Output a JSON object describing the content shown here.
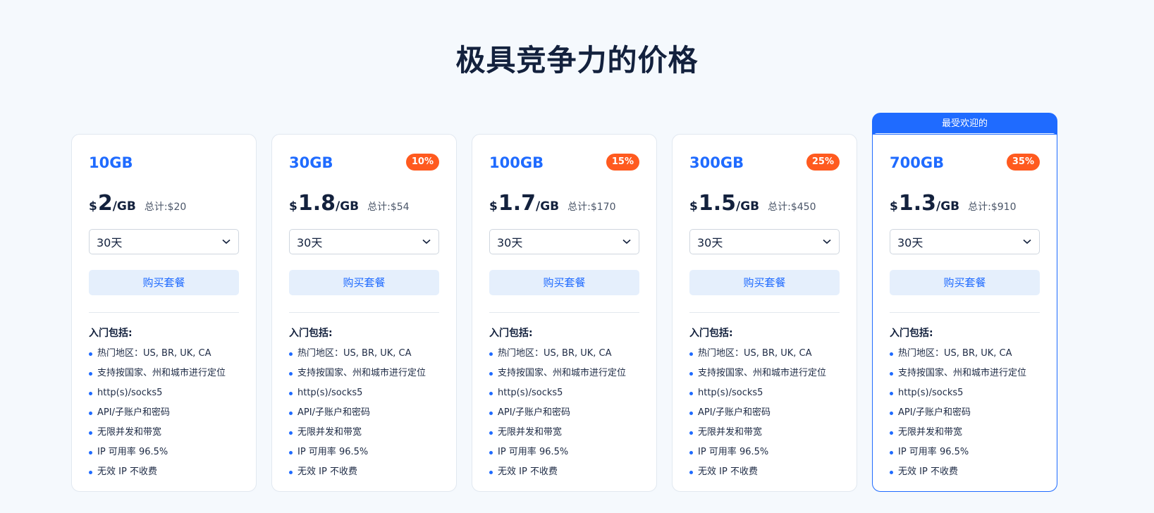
{
  "page": {
    "title": "极具竞争力的价格"
  },
  "featured_label": "最受欢迎的",
  "buy_label": "购买套餐",
  "features_heading": "入门包括:",
  "currency": "$",
  "unit": "/GB",
  "features": [
    "热门地区：US, BR, UK, CA",
    "支持按国家、州和城市进行定位",
    "http(s)/socks5",
    "API/子账户和密码",
    "无限并发和带宽",
    "IP 可用率 96.5%",
    "无效 IP 不收费"
  ],
  "plans": [
    {
      "size": "10GB",
      "badge": "",
      "price": "2",
      "total": "总计:$20",
      "duration": "30天",
      "featured": false
    },
    {
      "size": "30GB",
      "badge": "10%",
      "price": "1.8",
      "total": "总计:$54",
      "duration": "30天",
      "featured": false
    },
    {
      "size": "100GB",
      "badge": "15%",
      "price": "1.7",
      "total": "总计:$170",
      "duration": "30天",
      "featured": false
    },
    {
      "size": "300GB",
      "badge": "25%",
      "price": "1.5",
      "total": "总计:$450",
      "duration": "30天",
      "featured": false
    },
    {
      "size": "700GB",
      "badge": "35%",
      "price": "1.3",
      "total": "总计:$910",
      "duration": "30天",
      "featured": true
    }
  ],
  "colors": {
    "accent": "#1f6bff",
    "badge": "#ff5a1f",
    "button_bg": "#e5effc",
    "page_bg": "#f5f9fd"
  }
}
